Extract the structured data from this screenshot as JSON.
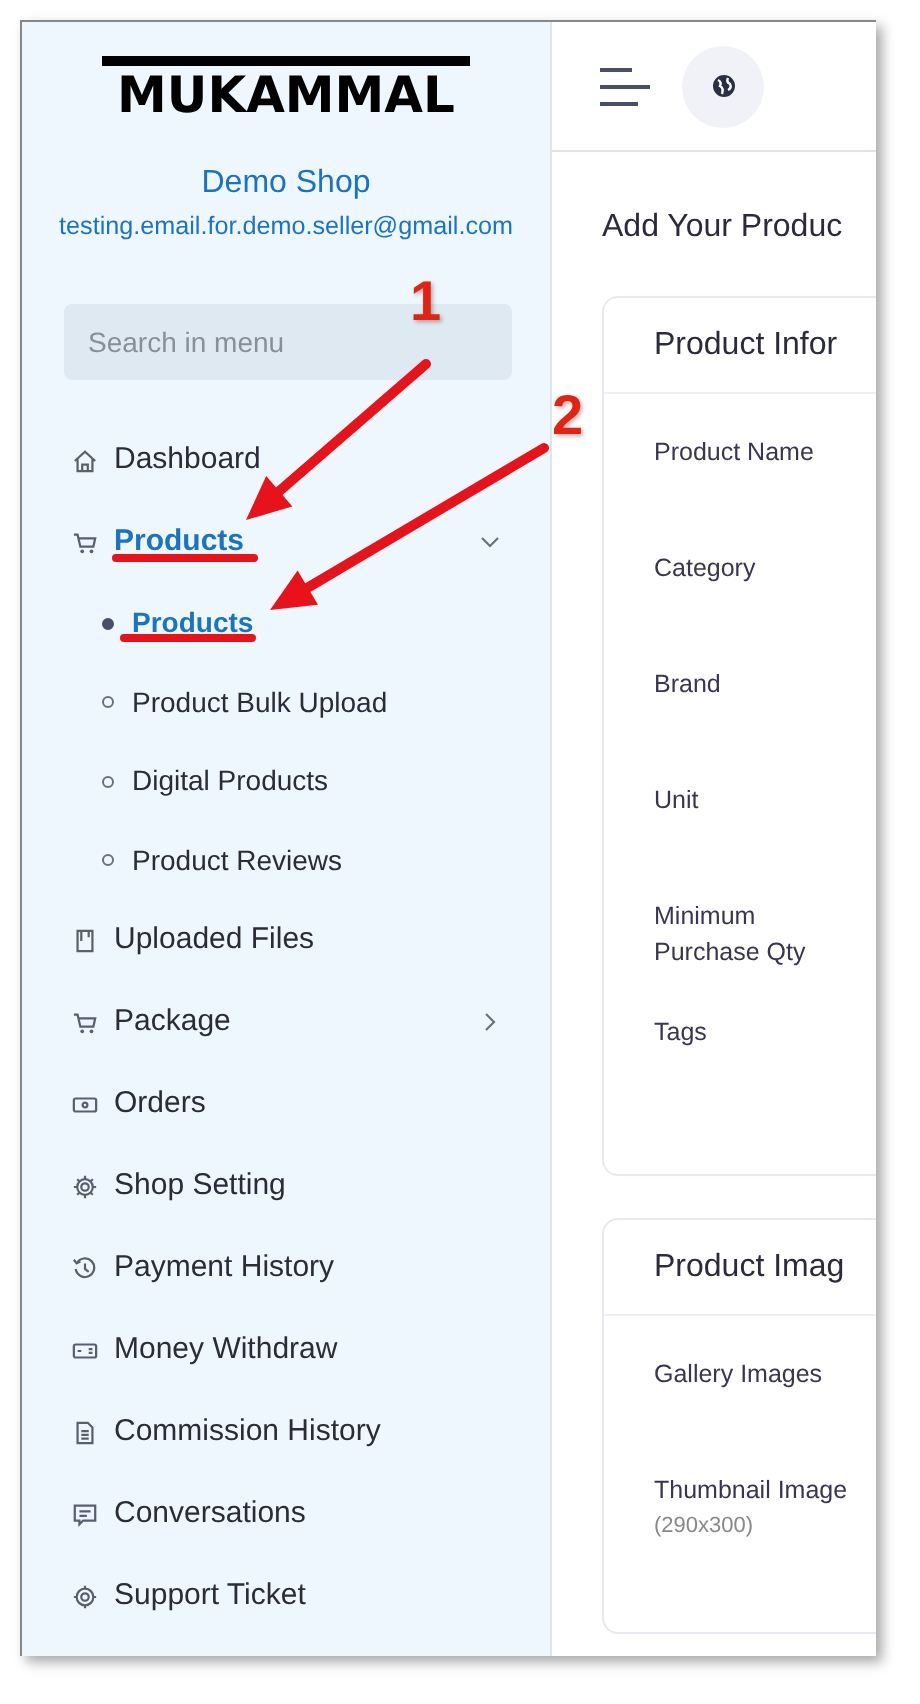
{
  "sidebar": {
    "logo": "MUKAMMAL",
    "shop_name": "Demo Shop",
    "email": "testing.email.for.demo.seller@gmail.com",
    "search": {
      "placeholder": "Search in menu"
    },
    "items": [
      {
        "label": "Dashboard",
        "selected": false
      },
      {
        "label": "Products",
        "selected": true,
        "expanded": true,
        "children": [
          {
            "label": "Products",
            "selected": true
          },
          {
            "label": "Product Bulk Upload",
            "selected": false
          },
          {
            "label": "Digital Products",
            "selected": false
          },
          {
            "label": "Product Reviews",
            "selected": false
          }
        ]
      },
      {
        "label": "Uploaded Files",
        "selected": false
      },
      {
        "label": "Package",
        "selected": false,
        "expanded": false
      },
      {
        "label": "Orders",
        "selected": false
      },
      {
        "label": "Shop Setting",
        "selected": false
      },
      {
        "label": "Payment History",
        "selected": false
      },
      {
        "label": "Money Withdraw",
        "selected": false
      },
      {
        "label": "Commission History",
        "selected": false
      },
      {
        "label": "Conversations",
        "selected": false
      },
      {
        "label": "Support Ticket",
        "selected": false
      }
    ]
  },
  "main": {
    "title": "Add Your Produc",
    "cards": [
      {
        "title": "Product Infor",
        "fields": [
          {
            "label": "Product Name"
          },
          {
            "label": "Category"
          },
          {
            "label": "Brand"
          },
          {
            "label": "Unit"
          },
          {
            "label": "Minimum Purchase Qty"
          },
          {
            "label": "Tags"
          }
        ]
      },
      {
        "title": "Product Imag",
        "fields": [
          {
            "label": "Gallery Images"
          },
          {
            "label": "Thumbnail Image",
            "hint": "(290x300)"
          }
        ]
      }
    ]
  },
  "annotations": [
    {
      "number": "1"
    },
    {
      "number": "2"
    }
  ]
}
